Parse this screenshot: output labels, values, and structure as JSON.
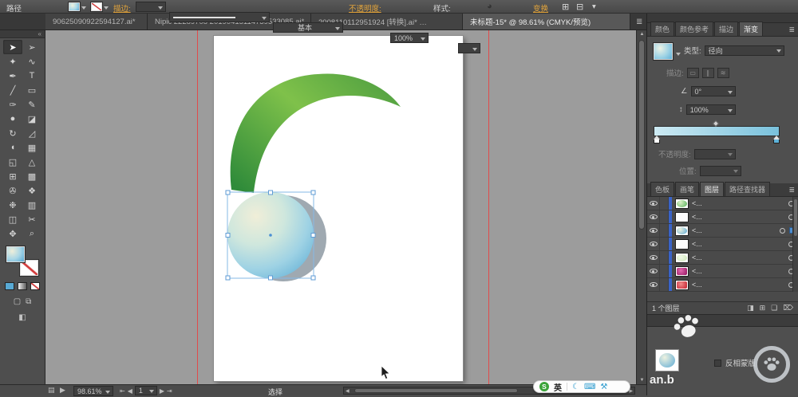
{
  "options_bar": {
    "selection_type": "路径",
    "stroke_link": "描边:",
    "brush_definition": "基本",
    "opacity_link": "不透明度:",
    "opacity_value": "100%",
    "style_label": "样式:",
    "transform_link": "变换"
  },
  "document_tabs": {
    "tab1": "90625090922594127.ai*",
    "tab2": "Nipic 22289708 20190415114739533085.ai*",
    "tab3": "2008110112951924 [转换].ai*  …",
    "tab4": "未标题-15* @ 98.61% (CMYK/预览)"
  },
  "toolbar": {
    "tools": [
      {
        "name": "selection",
        "glyph": "➤"
      },
      {
        "name": "direct-selection",
        "glyph": "➢"
      },
      {
        "name": "magic-wand",
        "glyph": "✦"
      },
      {
        "name": "lasso",
        "glyph": "∿"
      },
      {
        "name": "pen",
        "glyph": "✒"
      },
      {
        "name": "type",
        "glyph": "T"
      },
      {
        "name": "line-segment",
        "glyph": "╱"
      },
      {
        "name": "rectangle",
        "glyph": "▭"
      },
      {
        "name": "paintbrush",
        "glyph": "✑"
      },
      {
        "name": "pencil",
        "glyph": "✎"
      },
      {
        "name": "blob-brush",
        "glyph": "●"
      },
      {
        "name": "eraser",
        "glyph": "◪"
      },
      {
        "name": "rotate",
        "glyph": "↻"
      },
      {
        "name": "scale",
        "glyph": "◿"
      },
      {
        "name": "width",
        "glyph": "◖"
      },
      {
        "name": "free-transform",
        "glyph": "▦"
      },
      {
        "name": "shape-builder",
        "glyph": "◱"
      },
      {
        "name": "perspective-grid",
        "glyph": "△"
      },
      {
        "name": "mesh",
        "glyph": "⊞"
      },
      {
        "name": "gradient",
        "glyph": "▩"
      },
      {
        "name": "eyedropper",
        "glyph": "✇"
      },
      {
        "name": "blend",
        "glyph": "❖"
      },
      {
        "name": "symbol-sprayer",
        "glyph": "❉"
      },
      {
        "name": "column-graph",
        "glyph": "▥"
      },
      {
        "name": "artboard",
        "glyph": "◫"
      },
      {
        "name": "slice",
        "glyph": "✂"
      },
      {
        "name": "hand",
        "glyph": "✥"
      },
      {
        "name": "zoom",
        "glyph": "⌕"
      }
    ]
  },
  "gradient_panel": {
    "tab_color": "颜色",
    "tab_color_guide": "颜色参考",
    "tab_stroke": "描边",
    "tab_gradient": "渐变",
    "type_label": "类型:",
    "type_value": "径向",
    "stroke_row_label": "描边:",
    "angle_value": "0°",
    "aspect_value": "100%",
    "opacity_label": "不透明度:",
    "location_label": "位置:",
    "gradient_left_color": "#cdeaf3",
    "gradient_right_color": "#79c1dc"
  },
  "layers_panel": {
    "tab_swatches": "色板",
    "tab_brushes": "画笔",
    "tab_layers": "图层",
    "tab_pathfinder": "路径查找器",
    "row_label": "<...",
    "rows": [
      {
        "thumb": "green-sphere"
      },
      {
        "thumb": "white"
      },
      {
        "thumb": "blue-sphere"
      },
      {
        "thumb": "white"
      },
      {
        "thumb": "pale-green"
      },
      {
        "thumb": "magenta"
      },
      {
        "thumb": "red"
      }
    ],
    "count_label": "1 个图层"
  },
  "transparency_panel": {
    "invert_mask_label": "反相蒙版"
  },
  "status_bar": {
    "zoom_value": "98.61%",
    "artboard_number": "1",
    "tool_indicator": "选择"
  },
  "ime": {
    "logo": "S",
    "mode": "英"
  },
  "watermark": {
    "text": "an.b"
  },
  "icons": {
    "toolbar_collapse": "«",
    "tab_menu": "≣",
    "panel_menu": "≣",
    "angle": "∠",
    "aspect": "↕",
    "scroll_up": "▲",
    "scroll_down": "▼",
    "nav_first": "⇤",
    "nav_prev": "◀",
    "nav_next": "▶",
    "nav_last": "⇥",
    "hscroll_left": "◀",
    "hscroll_right": "▶",
    "doc_setup": "◕",
    "align_grid": "⊞",
    "align_grid2": "⊟",
    "overflow": "▾",
    "status_icon_a": "▤",
    "status_icon_b": "▶",
    "mask_btn": "◨",
    "new_sublayer_btn": "⊞",
    "new_layer_btn": "❏",
    "delete_btn": "⌦",
    "ime_moon": "☾",
    "ime_keyboard": "⌨",
    "ime_tools": "⚒",
    "stroke_btn1": "▭",
    "stroke_btn2": "∥",
    "stroke_btn3": "≋",
    "draw_normal": "▢",
    "draw_behind": "⧉",
    "screen_mode": "◧"
  }
}
